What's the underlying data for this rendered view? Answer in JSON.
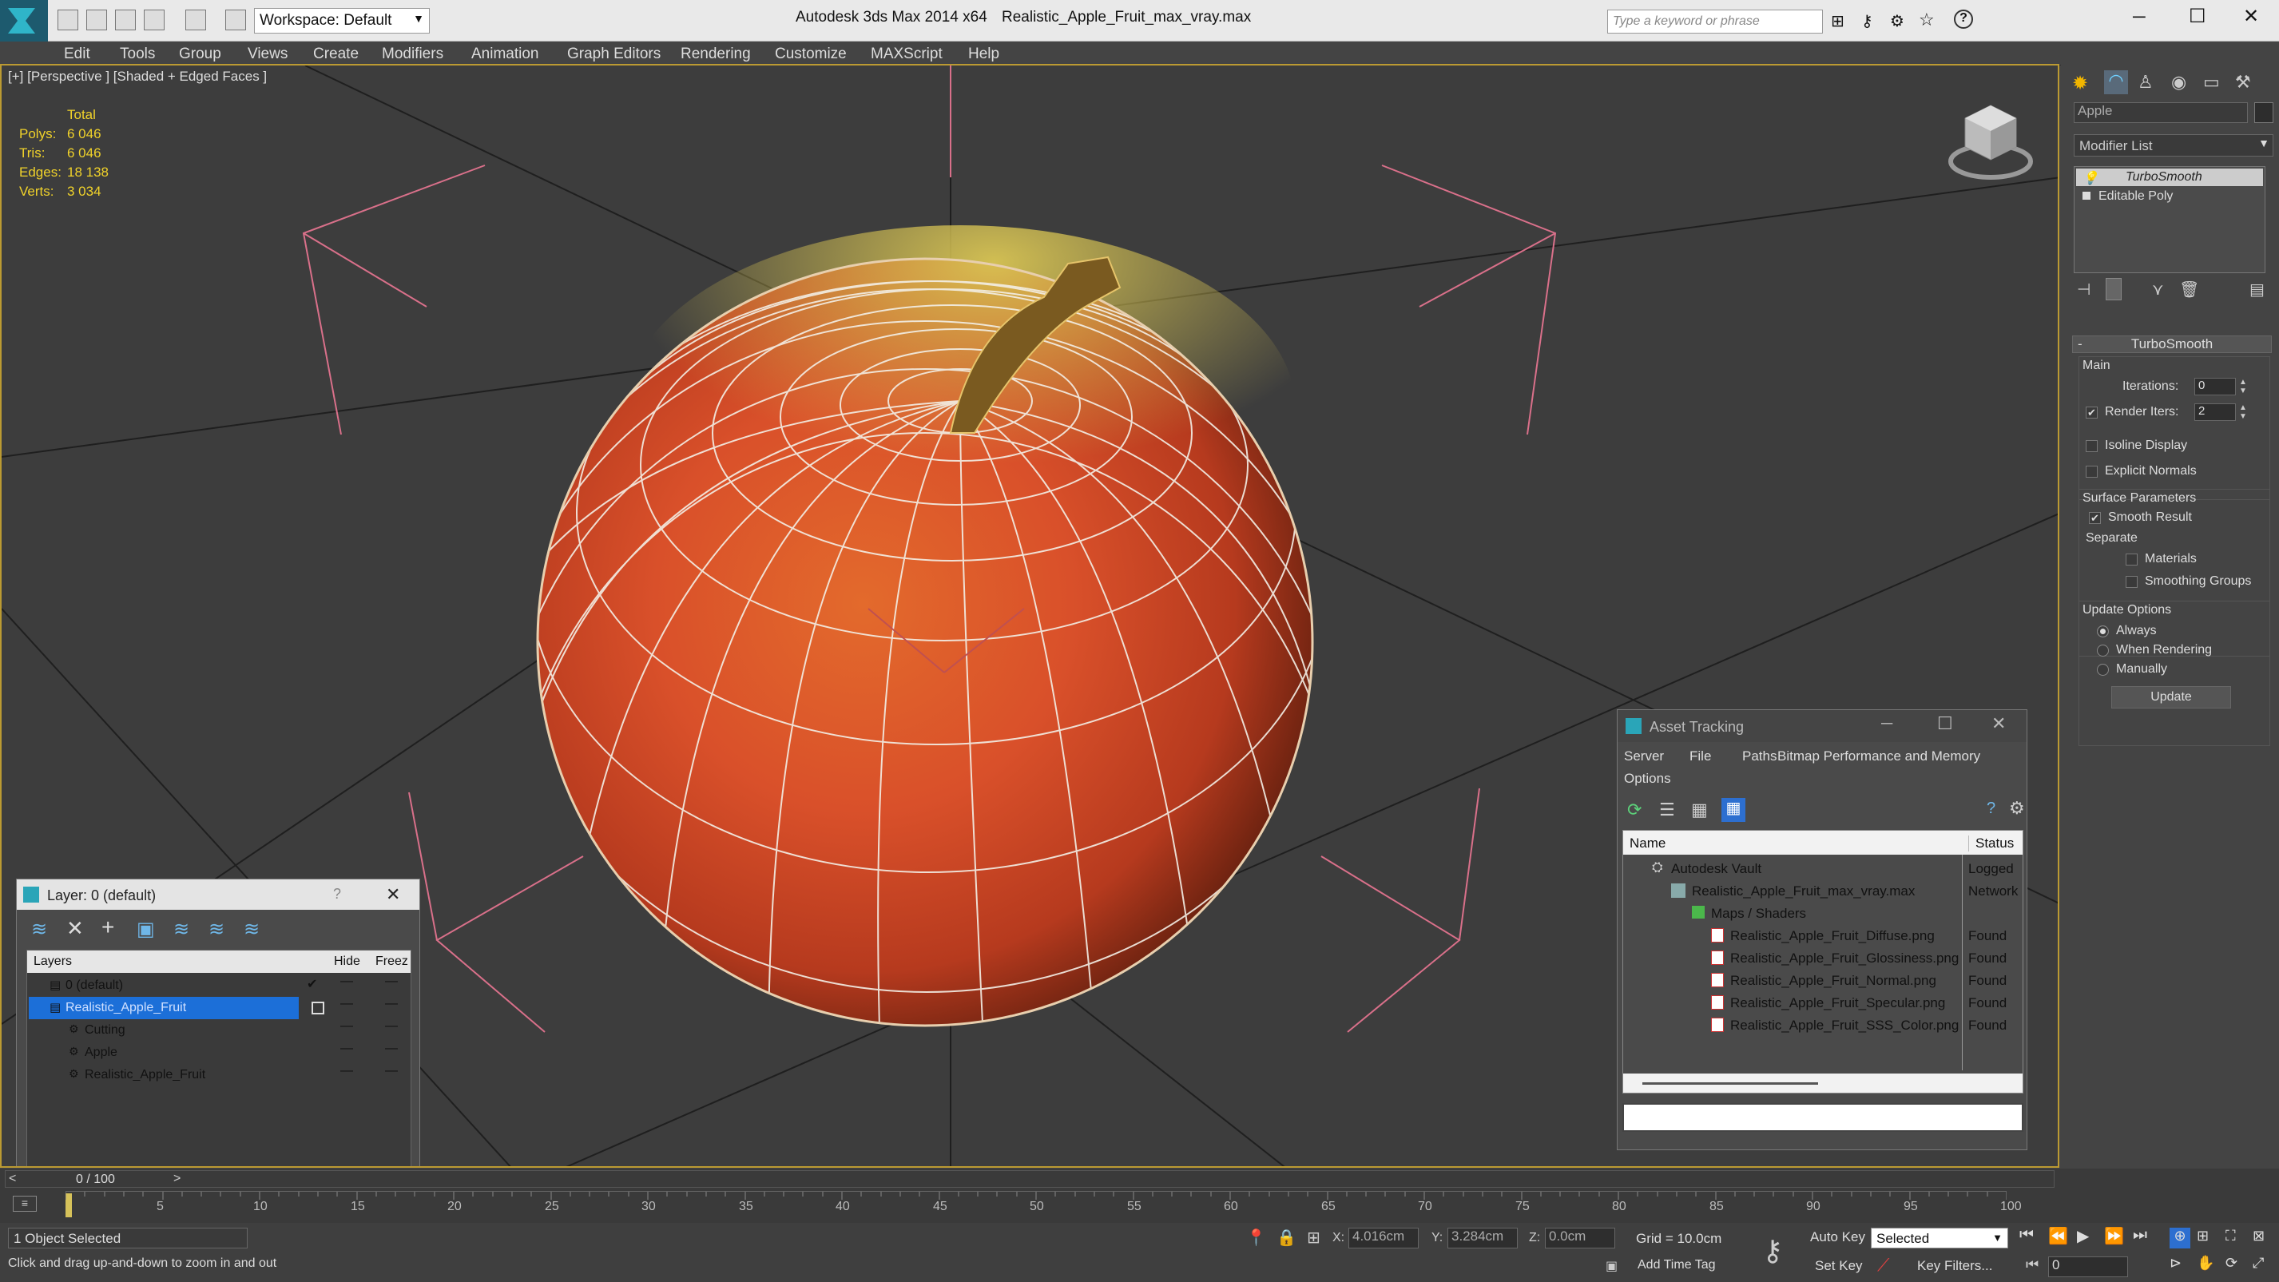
{
  "app": {
    "title": "Autodesk 3ds Max  2014 x64",
    "file": "Realistic_Apple_Fruit_max_vray.max",
    "workspace": "Workspace: Default",
    "search_placeholder": "Type a keyword or phrase",
    "help": "?"
  },
  "menu": [
    "Edit",
    "Tools",
    "Group",
    "Views",
    "Create",
    "Modifiers",
    "Animation",
    "Graph Editors",
    "Rendering",
    "Customize",
    "MAXScript",
    "Help"
  ],
  "viewport": {
    "label": "[+] [Perspective ] [Shaded + Edged Faces ]",
    "stats": {
      "header": "Total",
      "rows": [
        {
          "label": "Polys:",
          "value": "6 046"
        },
        {
          "label": "Tris:",
          "value": "6 046"
        },
        {
          "label": "Edges:",
          "value": "18 138"
        },
        {
          "label": "Verts:",
          "value": "3 034"
        }
      ]
    }
  },
  "command_panel": {
    "object_name": "Apple",
    "modifier_list": "Modifier List",
    "stack": [
      "TurboSmooth",
      "Editable Poly"
    ],
    "rollout_title": "TurboSmooth",
    "main_label": "Main",
    "iterations_label": "Iterations:",
    "iterations_value": "0",
    "render_iters_label": "Render Iters:",
    "render_iters_value": "2",
    "isoline": "Isoline Display",
    "explicit": "Explicit Normals",
    "surface_params": "Surface Parameters",
    "smooth_result": "Smooth Result",
    "separate": "Separate",
    "materials": "Materials",
    "smoothing_groups": "Smoothing Groups",
    "update_options": "Update Options",
    "always": "Always",
    "when_rendering": "When Rendering",
    "manually": "Manually",
    "update_btn": "Update"
  },
  "layer_dialog": {
    "title": "Layer: 0 (default)",
    "help": "?",
    "columns": [
      "Layers",
      "Hide",
      "Freez"
    ],
    "rows": [
      "0 (default)",
      "Realistic_Apple_Fruit",
      "Cutting",
      "Apple",
      "Realistic_Apple_Fruit"
    ]
  },
  "asset_dialog": {
    "title": "Asset Tracking",
    "menu": [
      "Server",
      "File",
      "Paths",
      "Bitmap Performance and Memory",
      "Options"
    ],
    "columns": [
      "Name",
      "Status"
    ],
    "rows": [
      {
        "name": "Autodesk Vault",
        "status": "Logged"
      },
      {
        "name": "Realistic_Apple_Fruit_max_vray.max",
        "status": "Network"
      },
      {
        "name": "Maps / Shaders",
        "status": ""
      },
      {
        "name": "Realistic_Apple_Fruit_Diffuse.png",
        "status": "Found"
      },
      {
        "name": "Realistic_Apple_Fruit_Glossiness.png",
        "status": "Found"
      },
      {
        "name": "Realistic_Apple_Fruit_Normal.png",
        "status": "Found"
      },
      {
        "name": "Realistic_Apple_Fruit_Specular.png",
        "status": "Found"
      },
      {
        "name": "Realistic_Apple_Fruit_SSS_Color.png",
        "status": "Found"
      }
    ]
  },
  "timeline": {
    "frame": "0 / 100",
    "prev": "<",
    "next": ">",
    "ticks": [
      "5",
      "10",
      "15",
      "20",
      "25",
      "30",
      "35",
      "40",
      "45",
      "50",
      "55",
      "60",
      "65",
      "70",
      "75",
      "80",
      "85",
      "90",
      "95",
      "100"
    ]
  },
  "status": {
    "selected": "1 Object Selected",
    "prompt": "Click and drag up-and-down to zoom in and out",
    "x_label": "X:",
    "x_value": "4.016cm",
    "y_label": "Y:",
    "y_value": "3.284cm",
    "z_label": "Z:",
    "z_value": "0.0cm",
    "grid": "Grid = 10.0cm",
    "add_time_tag": "Add Time Tag",
    "auto_key": "Auto Key",
    "set_key": "Set Key",
    "selected_dropdown": "Selected",
    "key_filters": "Key Filters...",
    "frame_field": "0"
  },
  "colors": {
    "accent": "#bb9a32",
    "selection": "#1c6fd8",
    "viewport_bg": "#3d3d3d"
  }
}
